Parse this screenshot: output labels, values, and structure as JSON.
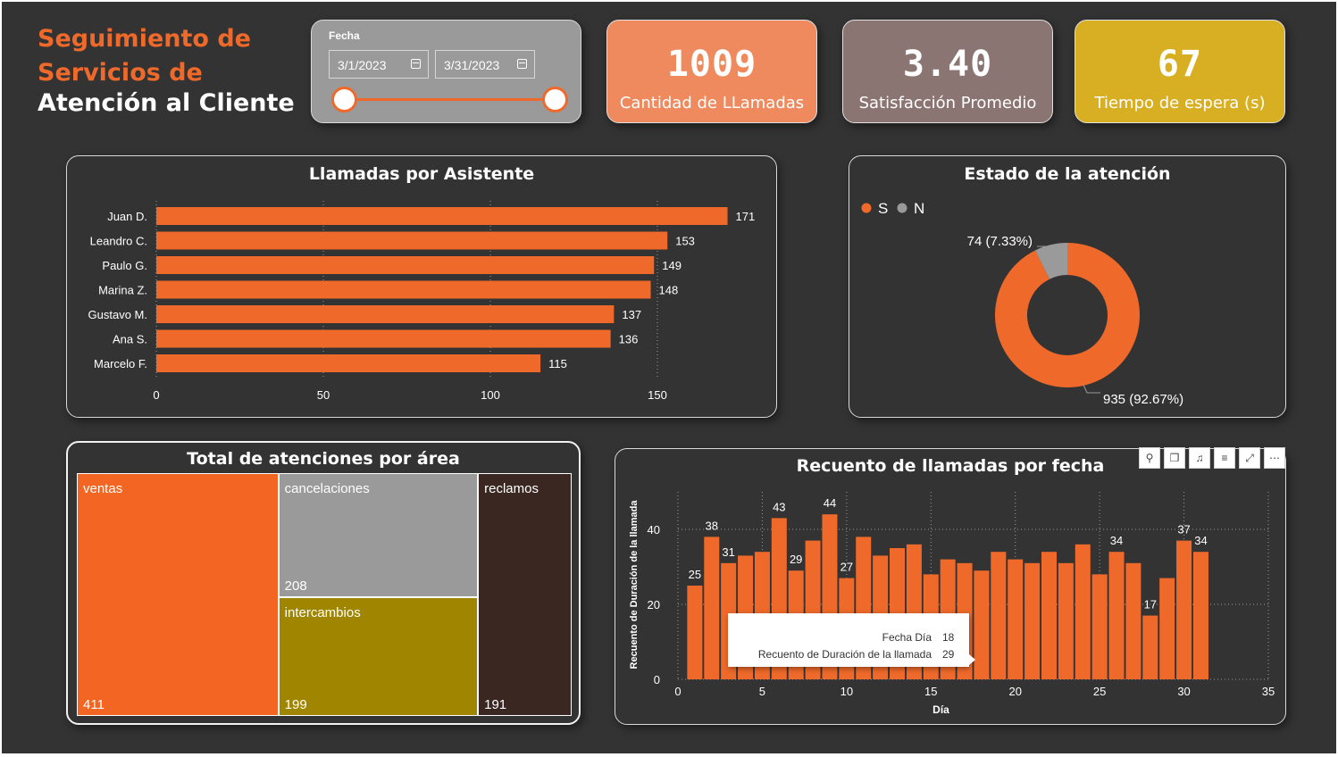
{
  "header": {
    "title_line1": "Seguimiento de",
    "title_line2": "Servicios de",
    "title_line3": "Atención al Cliente"
  },
  "date_filter": {
    "label": "Fecha",
    "start": "3/1/2023",
    "end": "3/31/2023"
  },
  "kpis": [
    {
      "value": "1009",
      "label": "Cantidad de LLamadas",
      "color": "#ee8a5e"
    },
    {
      "value": "3.40",
      "label": "Satisfacción Promedio",
      "color": "#8b7573"
    },
    {
      "value": "67",
      "label": "Tiempo de espera (s)",
      "color": "#d8ae22"
    }
  ],
  "colors": {
    "accent": "#ef6a2a",
    "background": "#333333",
    "grey": "#9a9a9a",
    "olive": "#a08600",
    "brown": "#3b2722"
  },
  "chart_data": [
    {
      "type": "bar",
      "orientation": "horizontal",
      "title": "Llamadas por Asistente",
      "categories": [
        "Juan D.",
        "Leandro C.",
        "Paulo G.",
        "Marina Z.",
        "Gustavo M.",
        "Ana S.",
        "Marcelo F."
      ],
      "values": [
        171,
        153,
        149,
        148,
        137,
        136,
        115
      ],
      "xlim": [
        0,
        150
      ],
      "xticks": [
        0,
        50,
        100,
        150
      ],
      "grid": true,
      "data_labels": true
    },
    {
      "type": "pie",
      "variant": "donut",
      "title": "Estado de la atención",
      "legend": {
        "position": "top-left",
        "entries": [
          "S",
          "N"
        ]
      },
      "slices": [
        {
          "name": "S",
          "value": 935,
          "label": "935 (92.67%)",
          "color": "#ef6a2a"
        },
        {
          "name": "N",
          "value": 74,
          "label": "74 (7.33%)",
          "color": "#9a9a9a"
        }
      ]
    },
    {
      "type": "treemap",
      "title": "Total de atenciones por área",
      "items": [
        {
          "name": "ventas",
          "value": 411,
          "color": "#f26522"
        },
        {
          "name": "cancelaciones",
          "value": 208,
          "color": "#9a9a9a"
        },
        {
          "name": "intercambios",
          "value": 199,
          "color": "#a08600"
        },
        {
          "name": "reclamos",
          "value": 191,
          "color": "#3b2722"
        }
      ]
    },
    {
      "type": "bar",
      "title": "Recuento de llamadas por fecha",
      "xlabel": "Día",
      "ylabel": "Recuento de Duración de la llamada",
      "x": [
        1,
        2,
        3,
        4,
        5,
        6,
        7,
        8,
        9,
        10,
        11,
        12,
        13,
        14,
        15,
        16,
        17,
        18,
        19,
        20,
        21,
        22,
        23,
        24,
        25,
        26,
        27,
        28,
        29,
        30,
        31
      ],
      "values": [
        25,
        38,
        31,
        33,
        34,
        43,
        29,
        37,
        44,
        27,
        38,
        33,
        35,
        36,
        28,
        32,
        31,
        29,
        34,
        32,
        31,
        34,
        31,
        36,
        28,
        34,
        31,
        17,
        27,
        37,
        34
      ],
      "labeled_points": [
        {
          "x": 1,
          "label": "25"
        },
        {
          "x": 2,
          "label": "38"
        },
        {
          "x": 3,
          "label": "31"
        },
        {
          "x": 6,
          "label": "43"
        },
        {
          "x": 7,
          "label": "29"
        },
        {
          "x": 9,
          "label": "44"
        },
        {
          "x": 10,
          "label": "27"
        },
        {
          "x": 26,
          "label": "34"
        },
        {
          "x": 28,
          "label": "17"
        },
        {
          "x": 30,
          "label": "37"
        },
        {
          "x": 31,
          "label": "34"
        }
      ],
      "xlim": [
        0,
        35
      ],
      "ylim": [
        0,
        40
      ],
      "xticks": [
        0,
        5,
        10,
        15,
        20,
        25,
        30,
        35
      ],
      "yticks": [
        0,
        20,
        40
      ],
      "grid": true,
      "tooltip": {
        "row1_label": "Fecha Día",
        "row1_value": "18",
        "row2_label": "Recuento de Duración de la llamada",
        "row2_value": "29"
      },
      "toolbar_icons": [
        "pin-icon",
        "copy-icon",
        "bell-icon",
        "filter-icon",
        "focus-mode-icon",
        "more-options-icon"
      ]
    }
  ]
}
